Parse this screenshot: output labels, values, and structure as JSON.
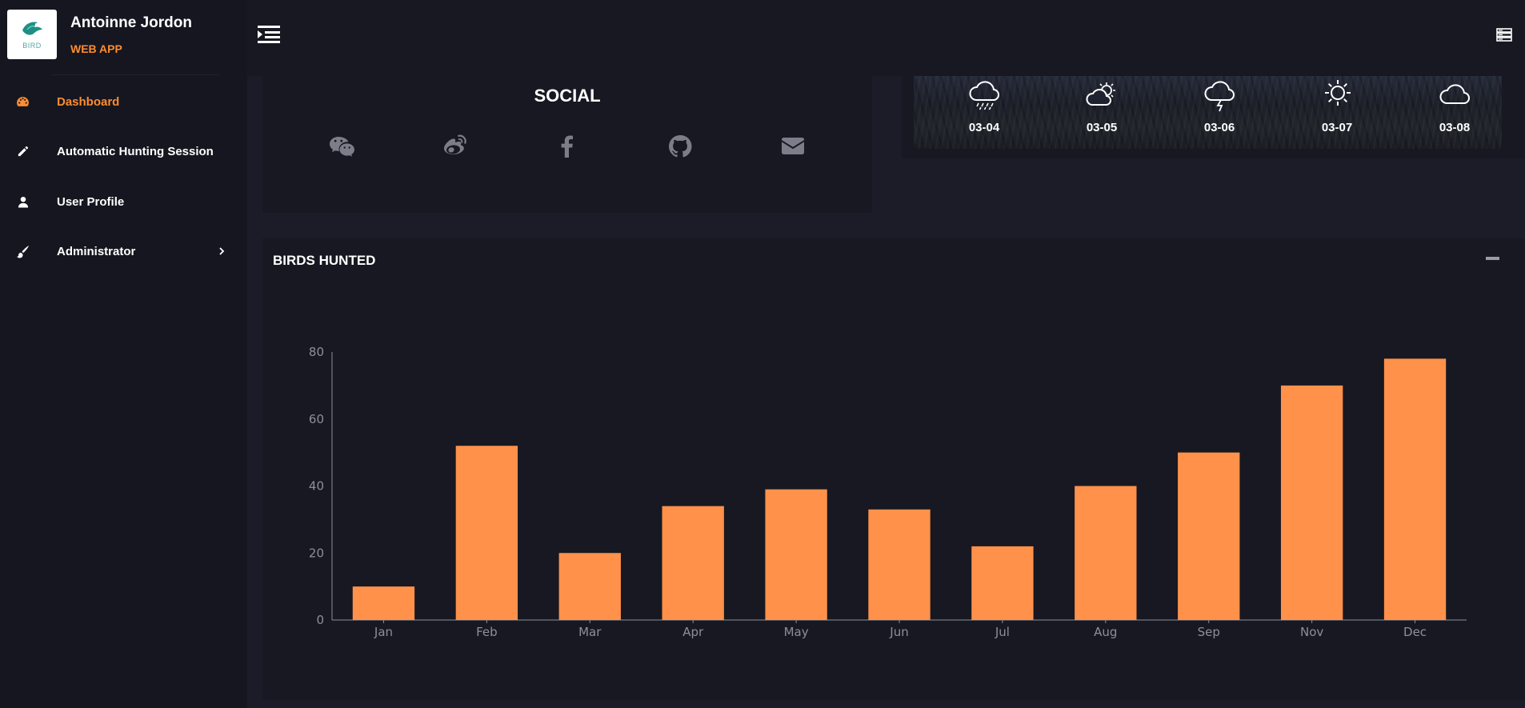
{
  "brand": {
    "logo_text": "BIRD",
    "user_name": "Antoinne Jordon",
    "subtitle": "WEB APP"
  },
  "sidebar": {
    "items": [
      {
        "label": "Dashboard",
        "icon": "palette-icon",
        "active": true
      },
      {
        "label": "Automatic Hunting Session",
        "icon": "pencil-icon",
        "active": false
      },
      {
        "label": "User Profile",
        "icon": "user-icon",
        "active": false
      },
      {
        "label": "Administrator",
        "icon": "brush-icon",
        "active": false,
        "has_submenu": true
      }
    ]
  },
  "topbar": {
    "left_icon": "menu-indent-icon",
    "right_icon": "server-icon"
  },
  "social": {
    "title": "SOCIAL",
    "icons": [
      "wechat-icon",
      "weibo-icon",
      "facebook-icon",
      "github-icon",
      "envelope-icon"
    ]
  },
  "weather": {
    "days": [
      {
        "date": "03-04",
        "icon": "rain-cloud-icon"
      },
      {
        "date": "03-05",
        "icon": "partly-sunny-cloud-icon"
      },
      {
        "date": "03-06",
        "icon": "thunder-cloud-icon"
      },
      {
        "date": "03-07",
        "icon": "sun-icon"
      },
      {
        "date": "03-08",
        "icon": "cloud-icon"
      }
    ]
  },
  "chart_card": {
    "title": "BIRDS HUNTED"
  },
  "colors": {
    "accent": "#ff8c2f",
    "bar": "#ff914a",
    "background": "#171821"
  },
  "chart_data": {
    "type": "bar",
    "categories": [
      "Jan",
      "Feb",
      "Mar",
      "Apr",
      "May",
      "Jun",
      "Jul",
      "Aug",
      "Sep",
      "Nov",
      "Dec"
    ],
    "values": [
      10,
      52,
      20,
      34,
      39,
      33,
      22,
      40,
      50,
      70,
      78
    ],
    "ylim": [
      0,
      80
    ],
    "yticks": [
      0,
      20,
      40,
      60,
      80
    ],
    "title": "",
    "xlabel": "",
    "ylabel": "",
    "grid": false
  }
}
